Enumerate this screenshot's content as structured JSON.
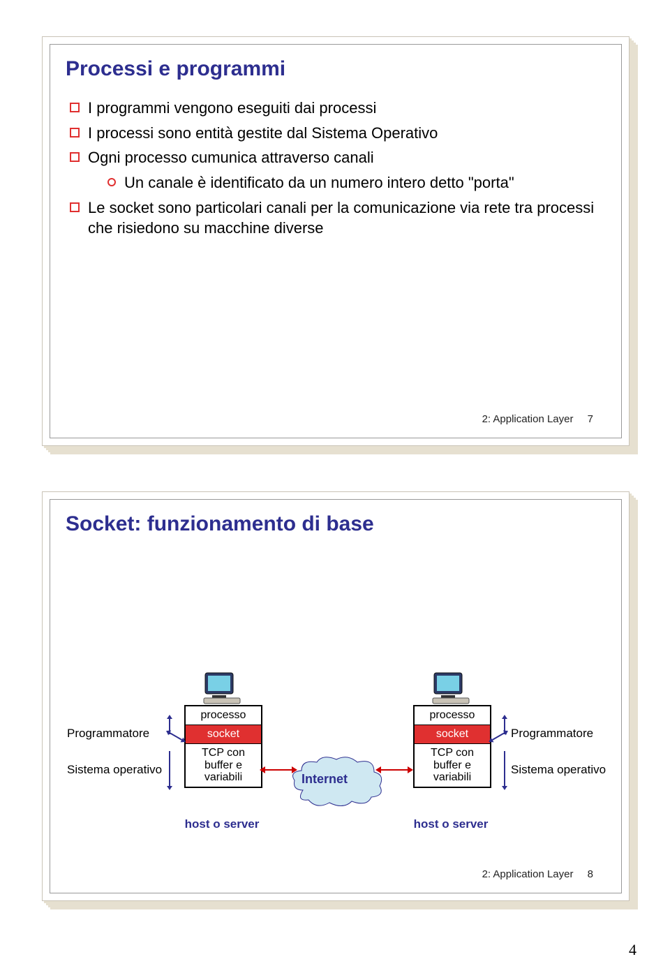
{
  "slide1": {
    "title": "Processi e programmi",
    "bullets": {
      "b1": "I programmi vengono eseguiti dai processi",
      "b2": "I processi sono entità gestite dal Sistema Operativo",
      "b3": "Ogni processo cumunica attraverso canali",
      "b3a": "Un canale è identificato da un numero intero detto \"porta\"",
      "b4": "Le socket sono particolari canali per la comunicazione via rete tra processi che risiedono su macchine diverse"
    },
    "footer": "2: Application Layer",
    "page": "7"
  },
  "slide2": {
    "title": "Socket: funzionamento di base",
    "labels": {
      "programmer": "Programmatore",
      "os": "Sistema operativo",
      "processo": "processo",
      "socket": "socket",
      "tcp": "TCP con buffer e variabili",
      "internet": "Internet",
      "host": "host o server"
    },
    "footer": "2: Application Layer",
    "page": "8"
  },
  "pageNumber": "4"
}
